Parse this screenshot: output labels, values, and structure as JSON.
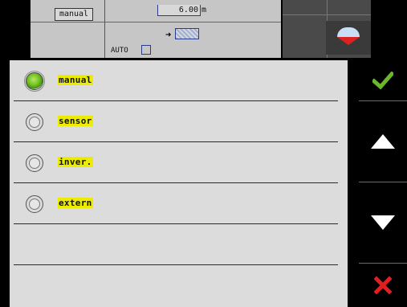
{
  "background": {
    "mode_value": "manual",
    "working_width_value": "6.00",
    "working_width_unit": "m",
    "auto_label": "AUTO"
  },
  "dialog": {
    "options": [
      {
        "label": "manual",
        "selected": true
      },
      {
        "label": "sensor",
        "selected": false
      },
      {
        "label": "inver.",
        "selected": false
      },
      {
        "label": "extern",
        "selected": false
      }
    ]
  },
  "side_buttons": [
    {
      "name": "confirm-button",
      "icon": "check-icon",
      "color": "#6ab82a"
    },
    {
      "name": "scroll-up-button",
      "icon": "arrow-up-icon",
      "color": "#ffffff"
    },
    {
      "name": "scroll-down-button",
      "icon": "arrow-down-icon",
      "color": "#ffffff"
    },
    {
      "name": "cancel-button",
      "icon": "close-icon",
      "color": "#e02020"
    }
  ],
  "colors": {
    "label_highlight": "#ecec00",
    "list_bg": "#dcdcdc",
    "selected_radio": "#6fbf1d"
  }
}
